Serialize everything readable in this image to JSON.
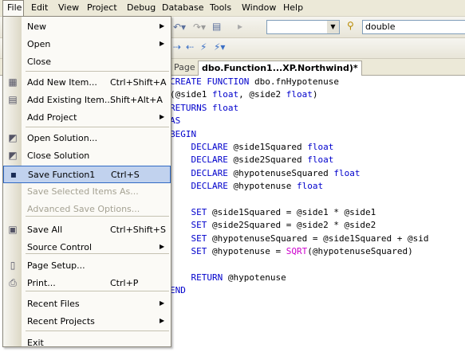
{
  "menubar": {
    "items": [
      "File",
      "Edit",
      "View",
      "Project",
      "Debug",
      "Database",
      "Tools",
      "Window",
      "Help"
    ]
  },
  "toolbar": {
    "combo_empty": "",
    "type_label": "double",
    "find_icon": "binoculars-icon",
    "undo_icon": "undo-icon",
    "redo_icon": "redo-icon",
    "run_icon": "play-icon"
  },
  "tabs": [
    {
      "label": "Page"
    },
    {
      "label": "dbo.Function1...XP.Northwind)*"
    }
  ],
  "file_menu": {
    "items": [
      {
        "label": "New",
        "shortcut": "",
        "submenu": true,
        "disabled": false,
        "icon": ""
      },
      {
        "label": "Open",
        "shortcut": "",
        "submenu": true,
        "disabled": false,
        "icon": ""
      },
      {
        "label": "Close",
        "shortcut": "",
        "submenu": false,
        "disabled": false,
        "icon": ""
      },
      {
        "label": "Add New Item...",
        "shortcut": "Ctrl+Shift+A",
        "submenu": false,
        "disabled": false,
        "icon": "new-item-icon"
      },
      {
        "label": "Add Existing Item...",
        "shortcut": "Shift+Alt+A",
        "submenu": false,
        "disabled": false,
        "icon": "existing-item-icon"
      },
      {
        "label": "Add Project",
        "shortcut": "",
        "submenu": true,
        "disabled": false,
        "icon": ""
      },
      {
        "label": "Open Solution...",
        "shortcut": "",
        "submenu": false,
        "disabled": false,
        "icon": "open-solution-icon"
      },
      {
        "label": "Close Solution",
        "shortcut": "",
        "submenu": false,
        "disabled": false,
        "icon": "close-solution-icon"
      },
      {
        "label": "Save Function1",
        "shortcut": "Ctrl+S",
        "submenu": false,
        "disabled": false,
        "icon": "save-icon",
        "selected": true
      },
      {
        "label": "Save Selected Items As...",
        "shortcut": "",
        "submenu": false,
        "disabled": true,
        "icon": ""
      },
      {
        "label": "Advanced Save Options...",
        "shortcut": "",
        "submenu": false,
        "disabled": true,
        "icon": ""
      },
      {
        "label": "Save All",
        "shortcut": "Ctrl+Shift+S",
        "submenu": false,
        "disabled": false,
        "icon": "save-all-icon"
      },
      {
        "label": "Source Control",
        "shortcut": "",
        "submenu": true,
        "disabled": false,
        "icon": ""
      },
      {
        "label": "Page Setup...",
        "shortcut": "",
        "submenu": false,
        "disabled": false,
        "icon": "page-setup-icon"
      },
      {
        "label": "Print...",
        "shortcut": "Ctrl+P",
        "submenu": false,
        "disabled": false,
        "icon": "print-icon"
      },
      {
        "label": "Recent Files",
        "shortcut": "",
        "submenu": true,
        "disabled": false,
        "icon": ""
      },
      {
        "label": "Recent Projects",
        "shortcut": "",
        "submenu": true,
        "disabled": false,
        "icon": ""
      },
      {
        "label": "Exit",
        "shortcut": "",
        "submenu": false,
        "disabled": false,
        "icon": ""
      }
    ]
  },
  "editor": {
    "lines": [
      "CREATE FUNCTION dbo.fnHypotenuse",
      "(@side1 float, @side2 float)",
      "RETURNS float",
      "AS",
      "BEGIN",
      "    DECLARE @side1Squared float",
      "    DECLARE @side2Squared float",
      "    DECLARE @hypotenuseSquared float",
      "    DECLARE @hypotenuse float",
      "",
      "    SET @side1Squared = @side1 * @side1",
      "    SET @side2Squared = @side2 * @side2",
      "    SET @hypotenuseSquared = @side1Squared + @sid",
      "    SET @hypotenuse = SQRT(@hypotenuseSquared)",
      "",
      "    RETURN @hypotenuse",
      "END"
    ]
  }
}
